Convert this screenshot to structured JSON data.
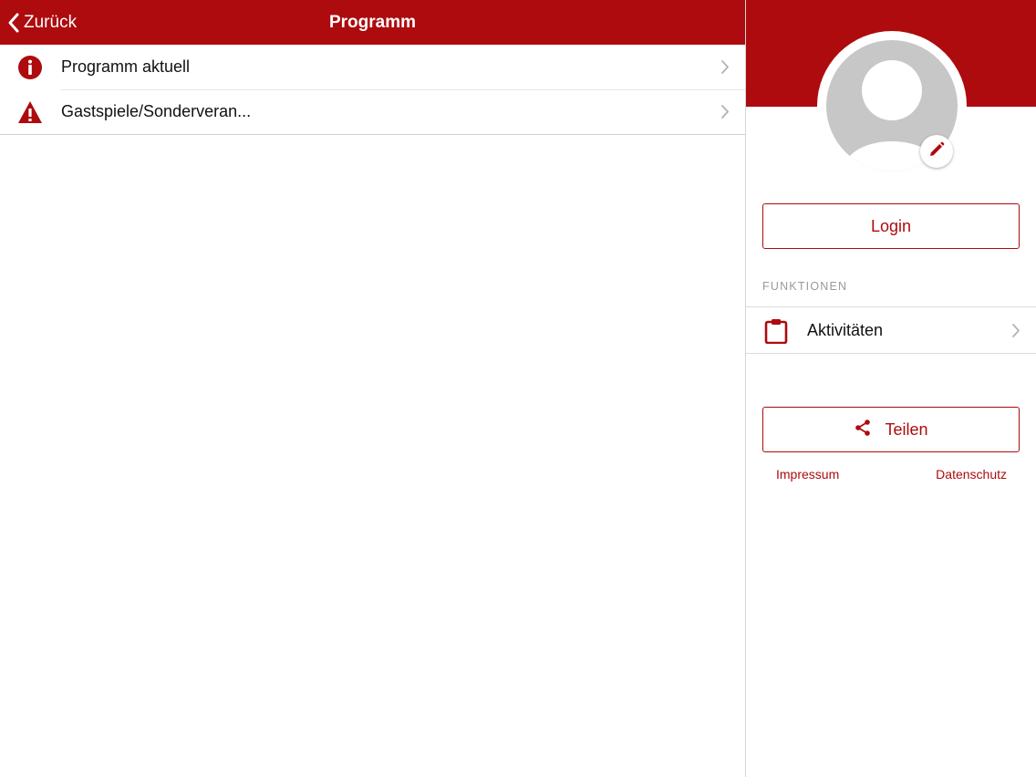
{
  "colors": {
    "accent": "#ad0b0e",
    "background": "#ffffff",
    "avatar_placeholder": "#c7c7c7",
    "divider": "#dcdcdc",
    "section_label": "#9a9a9a"
  },
  "navbar": {
    "back_label": "Zurück",
    "back_icon": "chevron-left-icon",
    "title": "Programm"
  },
  "main": {
    "items": [
      {
        "label": "Programm aktuell",
        "icon": "info-circle-icon"
      },
      {
        "label": "Gastspiele/Sonderveran...",
        "icon": "warning-triangle-icon"
      }
    ]
  },
  "side": {
    "avatar_icon": "user-avatar-icon",
    "edit_icon": "pencil-icon",
    "login_label": "Login",
    "section_label": "FUNKTIONEN",
    "functions": [
      {
        "label": "Aktivitäten",
        "icon": "clipboard-icon"
      }
    ],
    "share_label": "Teilen",
    "share_icon": "share-icon",
    "impressum_label": "Impressum",
    "datenschutz_label": "Datenschutz"
  }
}
